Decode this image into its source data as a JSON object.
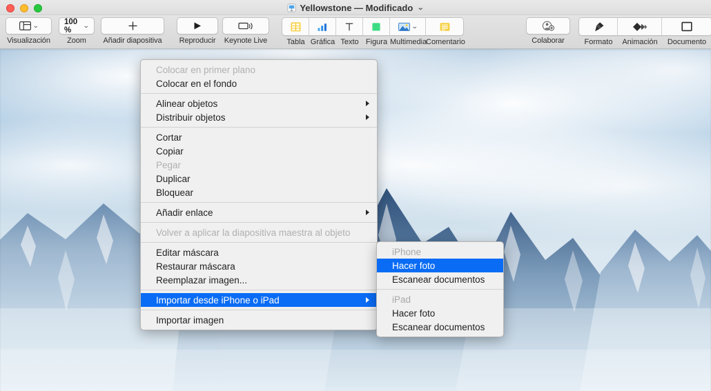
{
  "window": {
    "title": "Yellowstone — Modificado",
    "title_chevron": "chevron-down",
    "traffic_lights": {
      "close": "close",
      "minimize": "minimize",
      "zoom": "zoom"
    }
  },
  "toolbar": {
    "items": [
      {
        "name": "view",
        "label": "Visualización",
        "icon": "view-panes-icon",
        "has_chevron": true
      },
      {
        "name": "zoom",
        "label": "Zoom",
        "icon": "zoom-value",
        "value": "100 %",
        "has_chevron": true
      },
      {
        "name": "add-slide",
        "label": "Añadir diapositiva",
        "icon": "plus-icon",
        "has_chevron": false
      },
      {
        "name": "play",
        "label": "Reproducir",
        "icon": "play-triangle-icon",
        "has_chevron": false
      },
      {
        "name": "keynote-live",
        "label": "Keynote Live",
        "icon": "broadcast-icon",
        "has_chevron": false
      },
      {
        "name": "table",
        "label": "Tabla",
        "icon": "table-grid-icon",
        "has_chevron": false
      },
      {
        "name": "chart",
        "label": "Gráfica",
        "icon": "bar-chart-icon",
        "has_chevron": false
      },
      {
        "name": "text",
        "label": "Texto",
        "icon": "text-t-icon",
        "has_chevron": false
      },
      {
        "name": "shape",
        "label": "Figura",
        "icon": "square-shape-icon",
        "has_chevron": false
      },
      {
        "name": "media",
        "label": "Multimedia",
        "icon": "photo-icon",
        "has_chevron": true
      },
      {
        "name": "comment",
        "label": "Comentario",
        "icon": "comment-lines-icon",
        "has_chevron": false
      },
      {
        "name": "collaborate",
        "label": "Colaborar",
        "icon": "person-add-icon",
        "has_chevron": false
      },
      {
        "name": "format",
        "label": "Formato",
        "icon": "paintbrush-icon",
        "has_chevron": false
      },
      {
        "name": "animate",
        "label": "Animación",
        "icon": "diamonds-icon",
        "has_chevron": false
      },
      {
        "name": "document",
        "label": "Documento",
        "icon": "document-square-icon",
        "has_chevron": false
      }
    ]
  },
  "context_menu": {
    "items": [
      {
        "label": "Colocar en primer plano",
        "state": "disabled"
      },
      {
        "label": "Colocar en el fondo",
        "state": "normal"
      },
      {
        "separator": true
      },
      {
        "label": "Alinear objetos",
        "state": "normal",
        "submenu": true
      },
      {
        "label": "Distribuir objetos",
        "state": "normal",
        "submenu": true
      },
      {
        "separator": true
      },
      {
        "label": "Cortar",
        "state": "normal"
      },
      {
        "label": "Copiar",
        "state": "normal"
      },
      {
        "label": "Pegar",
        "state": "disabled"
      },
      {
        "label": "Duplicar",
        "state": "normal"
      },
      {
        "label": "Bloquear",
        "state": "normal"
      },
      {
        "separator": true
      },
      {
        "label": "Añadir enlace",
        "state": "normal",
        "submenu": true
      },
      {
        "separator": true
      },
      {
        "label": "Volver a aplicar la diapositiva maestra al objeto",
        "state": "disabled"
      },
      {
        "separator": true
      },
      {
        "label": "Editar máscara",
        "state": "normal"
      },
      {
        "label": "Restaurar máscara",
        "state": "normal"
      },
      {
        "label": "Reemplazar imagen...",
        "state": "normal"
      },
      {
        "separator": true
      },
      {
        "label": "Importar desde iPhone o iPad",
        "state": "selected",
        "submenu": true
      },
      {
        "separator": true
      },
      {
        "label": "Importar imagen",
        "state": "normal"
      }
    ]
  },
  "submenu": {
    "items": [
      {
        "label": "iPhone",
        "state": "header"
      },
      {
        "label": "Hacer foto",
        "state": "selected"
      },
      {
        "label": "Escanear documentos",
        "state": "normal"
      },
      {
        "separator": true
      },
      {
        "label": "iPad",
        "state": "header"
      },
      {
        "label": "Hacer foto",
        "state": "normal"
      },
      {
        "label": "Escanear documentos",
        "state": "normal"
      }
    ]
  },
  "slide": {
    "image_description": "Snow-covered mountain peaks under a blue sky with large white clouds"
  },
  "colors": {
    "accent": "#0a6cf5",
    "toolbar_bg": "#dedede",
    "menu_bg": "#f0f0f0",
    "disabled_text": "#b0b0b0",
    "table_icon": "#f5c518",
    "chart_icon": "#1e8cf0",
    "shape_icon": "#3ddc84",
    "comment_icon": "#f5c518"
  }
}
